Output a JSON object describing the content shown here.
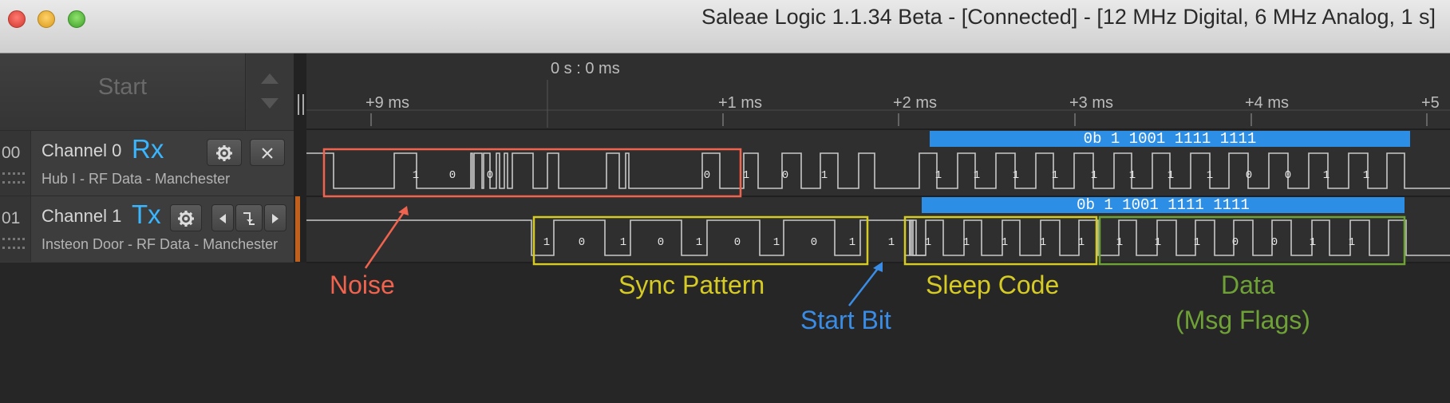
{
  "window": {
    "title": "Saleae Logic 1.1.34 Beta - [Connected] - [12 MHz Digital, 6 MHz Analog, 1 s]"
  },
  "toolbar": {
    "start_label": "Start"
  },
  "channels": [
    {
      "number": "00",
      "name": "Channel 0",
      "label": "Rx",
      "subtitle": "Hub I - RF Data - Manchester"
    },
    {
      "number": "01",
      "name": "Channel 1",
      "label": "Tx",
      "subtitle": "Insteon Door - RF Data - Manchester"
    }
  ],
  "timeline": {
    "origin_label": "0 s : 0 ms",
    "ticks": [
      "+9 ms",
      "+1 ms",
      "+2 ms",
      "+3 ms",
      "+4 ms",
      "+5"
    ]
  },
  "decode": {
    "channel0": "0b 1 1001 1111 1111",
    "channel1": "0b 1 1001 1111 1111"
  },
  "bits": {
    "channel0": [
      "1",
      "0",
      "0",
      "0",
      "1",
      "0",
      "1",
      "1",
      "1",
      "1",
      "1",
      "1",
      "1",
      "1",
      "1",
      "0",
      "0",
      "1",
      "1"
    ],
    "channel1": [
      "1",
      "0",
      "1",
      "0",
      "1",
      "0",
      "1",
      "0",
      "1",
      "1",
      "1",
      "1",
      "1",
      "1",
      "1",
      "1",
      "1",
      "1",
      "0",
      "0",
      "1",
      "1"
    ]
  },
  "annotations": {
    "noise": {
      "text": "Noise",
      "color": "#f0634e"
    },
    "sync": {
      "text": "Sync Pattern",
      "color": "#d6cb25"
    },
    "start_bit": {
      "text": "Start Bit",
      "color": "#3a8de6"
    },
    "sleep": {
      "text": "Sleep Code",
      "color": "#d6cb25"
    },
    "data_line1": {
      "text": "Data",
      "color": "#6fa236"
    },
    "data_line2": {
      "text": "(Msg Flags)",
      "color": "#6fa236"
    }
  },
  "colors": {
    "channel_label": "#3ab6ff",
    "decode_bar": "#2d8ee6",
    "trace": "#c8c8c8"
  },
  "icons": [
    "gear-icon",
    "close-icon",
    "arrow-left-icon",
    "trigger-edge-icon",
    "arrow-right-icon"
  ]
}
